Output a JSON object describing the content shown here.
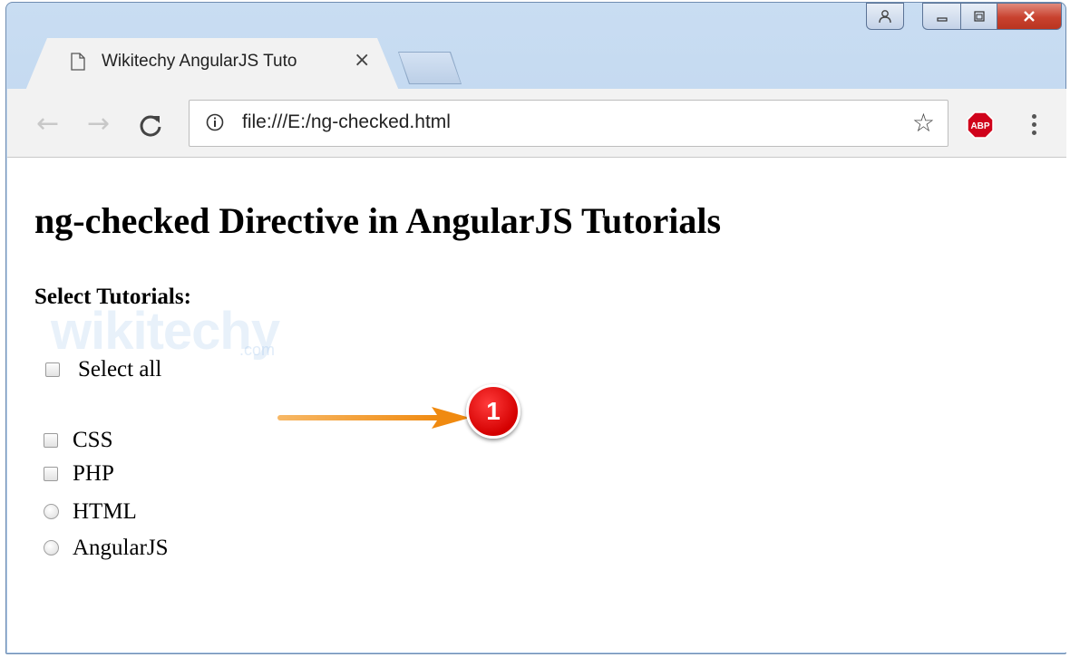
{
  "browser": {
    "tab_title": "Wikitechy AngularJS Tuto",
    "tab_close": "×",
    "url": "file:///E:/ng-checked.html",
    "star": "☆",
    "abp_label": "ABP"
  },
  "page": {
    "heading": "ng-checked Directive in AngularJS Tutorials",
    "subheading": "Select Tutorials:",
    "select_all_label": "Select all",
    "options": [
      {
        "label": "CSS",
        "control": "checkbox"
      },
      {
        "label": "PHP",
        "control": "checkbox"
      },
      {
        "label": "HTML",
        "control": "radio"
      },
      {
        "label": "AngularJS",
        "control": "radio"
      }
    ],
    "watermark": "wikitechy",
    "watermark_suffix": ".com"
  },
  "annotation": {
    "badge_number": "1",
    "arrow_color": "#f39c1f",
    "badge_color": "#e00000"
  }
}
